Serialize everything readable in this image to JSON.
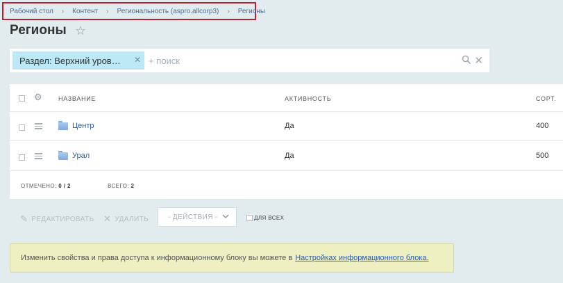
{
  "breadcrumb": {
    "items": [
      "Рабочий стол",
      "Контент",
      "Региональность (aspro.allcorp3)",
      "Регионы"
    ]
  },
  "page": {
    "title": "Регионы"
  },
  "filter": {
    "chip_label": "Раздел: Верхний уров…",
    "search_placeholder": "+ поиск"
  },
  "grid": {
    "columns": {
      "name": "НАЗВАНИЕ",
      "active": "АКТИВНОСТЬ",
      "sort": "СОРТ."
    },
    "rows": [
      {
        "name": "Центр",
        "active": "Да",
        "sort": "400"
      },
      {
        "name": "Урал",
        "active": "Да",
        "sort": "500"
      }
    ],
    "footer": {
      "selected_label": "ОТМЕЧЕНО:",
      "selected_value": "0 / 2",
      "total_label": "ВСЕГО:",
      "total_value": "2"
    }
  },
  "actions": {
    "edit": "РЕДАКТИРОВАТЬ",
    "delete": "УДАЛИТЬ",
    "select": "- ДЕЙСТВИЯ -",
    "all": "ДЛЯ ВСЕХ"
  },
  "notice": {
    "text": "Изменить свойства и права доступа к информационному блоку вы можете в",
    "link": "Настройках информационного блока."
  },
  "colors": {
    "accent_link": "#2a5db0",
    "breadcrumb_highlight": "#b52231",
    "chip_bg": "#bde8f6"
  }
}
